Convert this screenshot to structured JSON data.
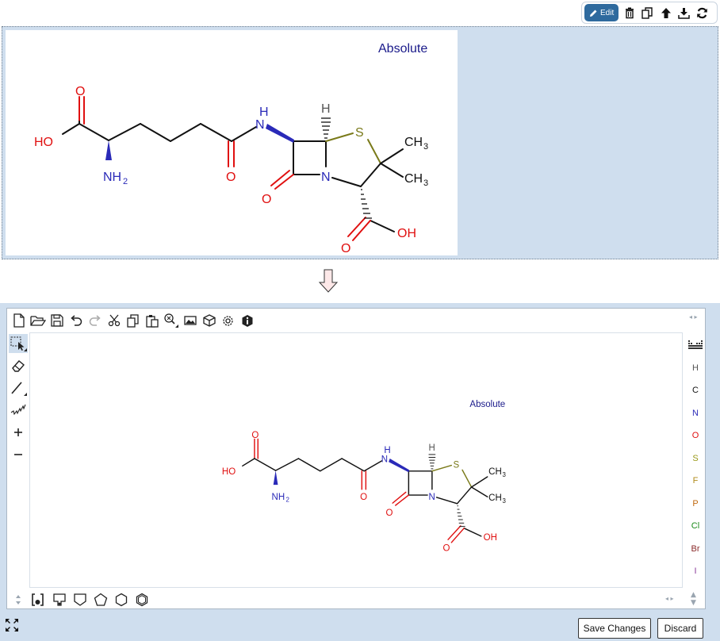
{
  "top_toolbar": {
    "edit_label": "Edit",
    "icons": [
      "pencil-icon",
      "trash-icon",
      "copy-icon",
      "arrow-up-icon",
      "download-icon",
      "refresh-icon"
    ]
  },
  "molecule": {
    "absolute_label": "Absolute",
    "atom_labels": {
      "o_top": "O",
      "ho": "HO",
      "nh2_n": "NH",
      "nh2_sub": "2",
      "o_mid": "O",
      "n_amide": "N",
      "h_amide": "H",
      "h_stereo": "H",
      "s": "S",
      "ch3_top": "CH",
      "ch3_top_sub": "3",
      "ch3_bot": "CH",
      "ch3_bot_sub": "3",
      "n_ring": "N",
      "o_lactam": "O",
      "o_acid": "O",
      "oh": "OH"
    }
  },
  "editor": {
    "buttons": {
      "save": "Save Changes",
      "discard": "Discard"
    },
    "elements": [
      "H",
      "C",
      "N",
      "O",
      "S",
      "F",
      "P",
      "Cl",
      "Br",
      "I"
    ],
    "element_colors": {
      "H": "#555555",
      "C": "#111111",
      "N": "#2a2ab8",
      "O": "#e01010",
      "S": "#9a9a1a",
      "F": "#b08a1a",
      "P": "#c06a10",
      "Cl": "#1a8a1a",
      "Br": "#8a2a2a",
      "I": "#8a3a9a"
    }
  },
  "colors": {
    "carbon": "#111111",
    "oxygen": "#e01010",
    "nitrogen": "#2a2ab8",
    "sulfur": "#7a7a1a",
    "label": "#1a1a8a",
    "panel": "#cfdeee",
    "edit_button": "#2e6a9e"
  }
}
